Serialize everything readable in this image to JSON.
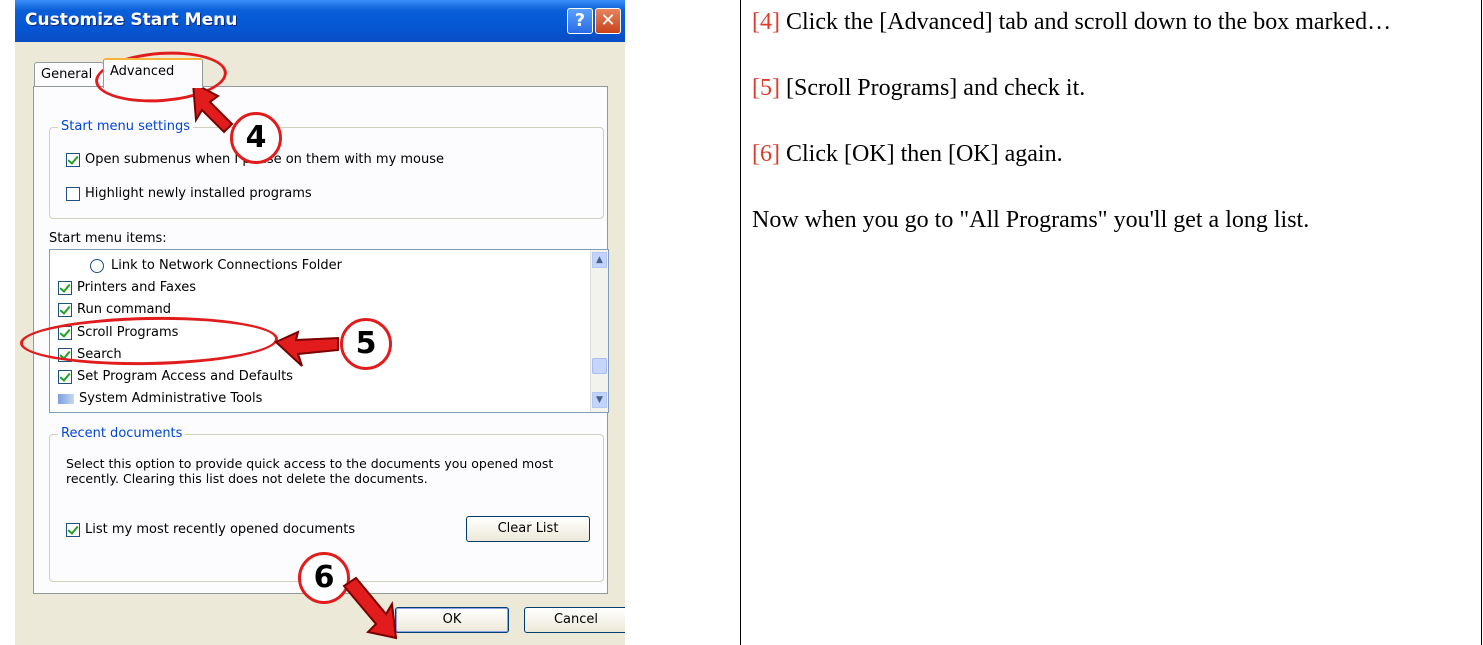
{
  "dialog": {
    "title": "Customize Start Menu",
    "help_label": "?",
    "close_label": "✕",
    "tabs": [
      {
        "label": "General"
      },
      {
        "label": "Advanced"
      }
    ],
    "start_menu_settings": {
      "legend": "Start menu settings",
      "options": [
        {
          "label": "Open submenus when I pause on them with my mouse",
          "checked": true
        },
        {
          "label": "Highlight newly installed programs",
          "checked": false
        }
      ]
    },
    "items": {
      "label": "Start menu items:",
      "list": [
        {
          "label": "Link to Network Connections Folder",
          "kind": "radio"
        },
        {
          "label": "Printers and Faxes",
          "kind": "check",
          "checked": true
        },
        {
          "label": "Run command",
          "kind": "check",
          "checked": true
        },
        {
          "label": "Scroll Programs",
          "kind": "check",
          "checked": true
        },
        {
          "label": "Search",
          "kind": "check",
          "checked": true
        },
        {
          "label": "Set Program Access and Defaults",
          "kind": "check",
          "checked": true
        },
        {
          "label": "System Administrative Tools",
          "kind": "icon"
        }
      ]
    },
    "recent": {
      "legend": "Recent documents",
      "description": "Select this option to provide quick access to the documents you opened most recently.  Clearing this list does not delete the documents.",
      "option_label": "List my most recently opened documents",
      "option_checked": true,
      "clear_label": "Clear List"
    },
    "ok_label": "OK",
    "cancel_label": "Cancel"
  },
  "annotations": {
    "step4": "4",
    "step5": "5",
    "step6": "6",
    "color": "#e21c1c"
  },
  "instructions": {
    "p1_num": "[4]",
    "p1_text": "  Click the [Advanced] tab and scroll down to the box marked…",
    "p2_num": "[5]",
    "p2_text": "  [Scroll Programs] and check it.",
    "p3_num": "[6]",
    "p3_text": " Click [OK] then [OK] again.",
    "p4_text": "Now when you go to \"All Programs\" you'll get a long list."
  }
}
